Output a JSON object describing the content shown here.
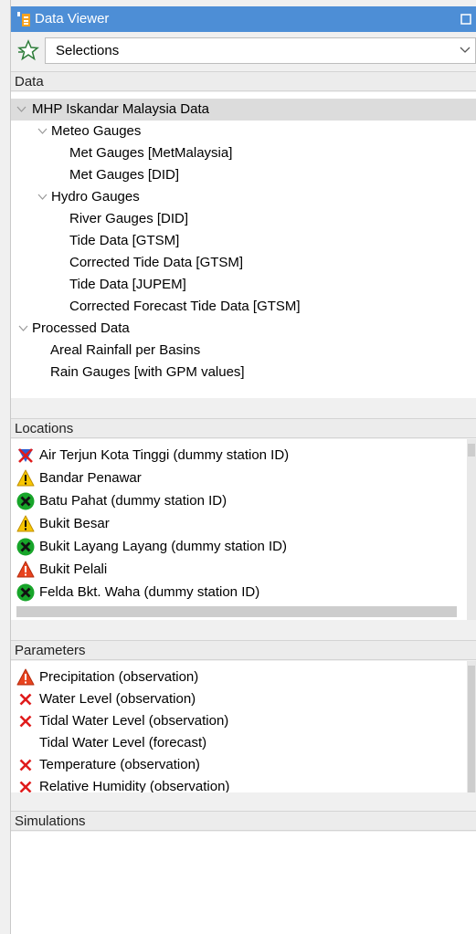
{
  "window": {
    "title": "Data Viewer"
  },
  "selector": {
    "value": "Selections"
  },
  "data_section": {
    "header": "Data",
    "tree": [
      {
        "label": "MHP Iskandar Malaysia Data"
      },
      {
        "label": "Meteo Gauges"
      },
      {
        "label": "Met Gauges [MetMalaysia]"
      },
      {
        "label": "Met Gauges [DID]"
      },
      {
        "label": "Hydro Gauges"
      },
      {
        "label": "River Gauges [DID]"
      },
      {
        "label": "Tide Data [GTSM]"
      },
      {
        "label": "Corrected Tide Data [GTSM]"
      },
      {
        "label": "Tide Data [JUPEM]"
      },
      {
        "label": "Corrected Forecast Tide Data [GTSM]"
      },
      {
        "label": "Processed Data"
      },
      {
        "label": "Areal Rainfall per Basins"
      },
      {
        "label": "Rain Gauges [with GPM values]"
      }
    ]
  },
  "locations_section": {
    "header": "Locations",
    "items": [
      {
        "label": "Air Terjun Kota Tinggi (dummy station ID)",
        "icon": "blue-red-x-icon"
      },
      {
        "label": "Bandar Penawar",
        "icon": "warning-yellow-icon"
      },
      {
        "label": "Batu Pahat (dummy station ID)",
        "icon": "green-circle-x-icon"
      },
      {
        "label": "Bukit Besar",
        "icon": "warning-yellow-icon"
      },
      {
        "label": "Bukit Layang Layang (dummy station ID)",
        "icon": "green-circle-x-icon"
      },
      {
        "label": "Bukit Pelali",
        "icon": "warning-red-icon"
      },
      {
        "label": "Felda Bkt. Waha (dummy station ID)",
        "icon": "green-circle-x-icon"
      }
    ]
  },
  "parameters_section": {
    "header": "Parameters",
    "items": [
      {
        "label": "Precipitation (observation)",
        "icon": "warning-red-icon"
      },
      {
        "label": "Water Level (observation)",
        "icon": "red-x-icon"
      },
      {
        "label": "Tidal Water Level (observation)",
        "icon": "red-x-icon"
      },
      {
        "label": "Tidal Water Level (forecast)",
        "icon": ""
      },
      {
        "label": "Temperature (observation)",
        "icon": "red-x-icon"
      },
      {
        "label": "Relative Humidity (observation)",
        "icon": "red-x-icon"
      }
    ]
  },
  "simulations_section": {
    "header": "Simulations"
  },
  "colors": {
    "titlebar": "#4d8ed6",
    "warning_yellow": "#f7c600",
    "warning_red": "#e8431e",
    "ok_green": "#18a52a",
    "error_red": "#e01b1b"
  }
}
